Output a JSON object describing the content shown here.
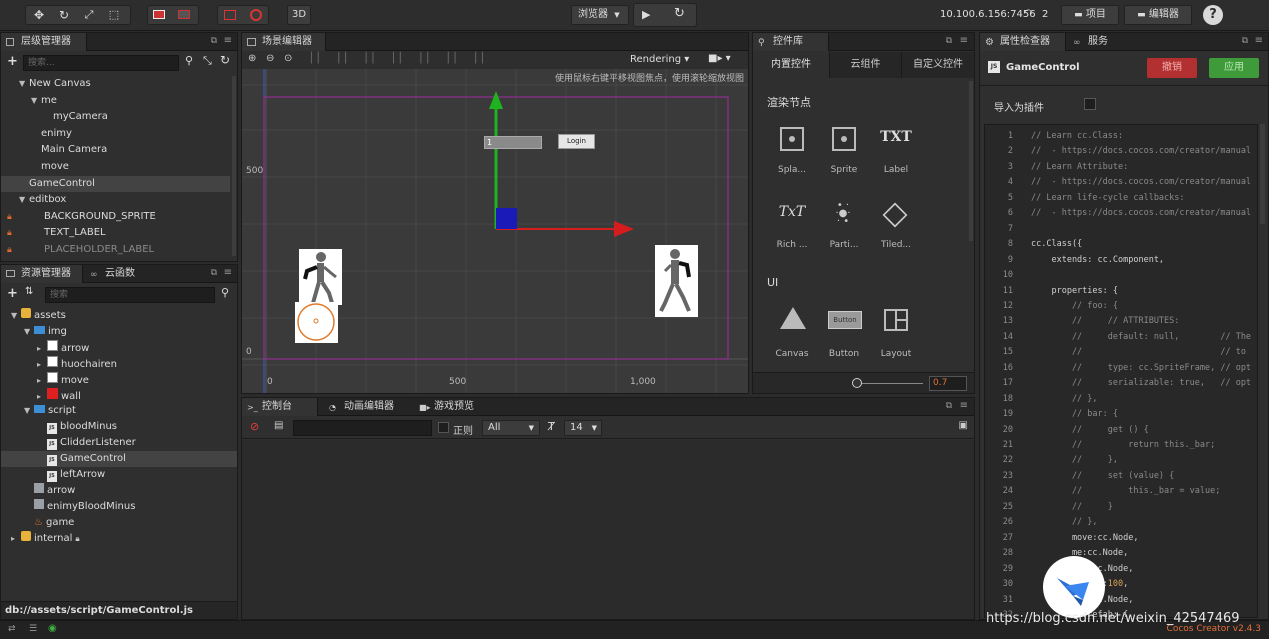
{
  "toolbar": {
    "transform_tools": [
      "move-tool",
      "rotate-tool",
      "scale-tool",
      "rect-tool"
    ],
    "mode_3d": "3D",
    "preview_target": "浏览器",
    "ip_address": "10.100.6.156:7456",
    "connections": "2",
    "project_label": "项目",
    "editor_label": "编辑器",
    "help": "?"
  },
  "hierarchy": {
    "title": "层级管理器",
    "search_placeholder": "搜索...",
    "items": [
      {
        "label": "New Canvas",
        "depth": 1,
        "expanded": true
      },
      {
        "label": "me",
        "depth": 2,
        "expanded": true
      },
      {
        "label": "myCamera",
        "depth": 3
      },
      {
        "label": "enimy",
        "depth": 2
      },
      {
        "label": "Main Camera",
        "depth": 2
      },
      {
        "label": "move",
        "depth": 2
      },
      {
        "label": "GameControl",
        "depth": 1,
        "selected": true
      },
      {
        "label": "editbox",
        "depth": 1,
        "expanded": true
      },
      {
        "label": "BACKGROUND_SPRITE",
        "depth": 2,
        "locked": true
      },
      {
        "label": "TEXT_LABEL",
        "depth": 2,
        "locked": true
      },
      {
        "label": "PLACEHOLDER_LABEL",
        "depth": 2,
        "locked": true,
        "dim": true
      }
    ]
  },
  "assets": {
    "tab_assets": "资源管理器",
    "tab_cloud": "云函数",
    "search_placeholder": "搜索",
    "items": [
      {
        "label": "assets",
        "depth": 0,
        "type": "db"
      },
      {
        "label": "img",
        "depth": 1,
        "type": "folder"
      },
      {
        "label": "arrow",
        "depth": 2,
        "type": "image"
      },
      {
        "label": "huochairen",
        "depth": 2,
        "type": "image"
      },
      {
        "label": "move",
        "depth": 2,
        "type": "image"
      },
      {
        "label": "wall",
        "depth": 2,
        "type": "image-red"
      },
      {
        "label": "script",
        "depth": 1,
        "type": "folder"
      },
      {
        "label": "bloodMinus",
        "depth": 2,
        "type": "js"
      },
      {
        "label": "ClidderListener",
        "depth": 2,
        "type": "js"
      },
      {
        "label": "GameControl",
        "depth": 2,
        "type": "js",
        "selected": true
      },
      {
        "label": "leftArrow",
        "depth": 2,
        "type": "js"
      },
      {
        "label": "arrow",
        "depth": 1,
        "type": "prefab"
      },
      {
        "label": "enimyBloodMinus",
        "depth": 1,
        "type": "prefab"
      },
      {
        "label": "game",
        "depth": 1,
        "type": "scene"
      },
      {
        "label": "internal",
        "depth": 0,
        "type": "db-lock"
      }
    ],
    "path": "db://assets/script/GameControl.js"
  },
  "scene": {
    "title": "场景编辑器",
    "rendering": "Rendering",
    "hint": "使用鼠标右键平移视图焦点，使用滚轮缩放视图",
    "y_labels": [
      "500",
      "0"
    ],
    "x_labels": [
      "0",
      "500",
      "1,000"
    ],
    "editbox_value": "1",
    "login_button": "Login"
  },
  "bottom": {
    "tabs": [
      "控制台",
      "动画编辑器",
      "游戏预览"
    ],
    "regex_label": "正则",
    "filter": "All",
    "font_size": "14"
  },
  "widgets": {
    "title": "控件库",
    "tabs": [
      "内置控件",
      "云组件",
      "自定义控件"
    ],
    "section_render": "渲染节点",
    "section_ui": "UI",
    "render_items": [
      "Spla...",
      "Sprite",
      "Label",
      "Rich ...",
      "Parti...",
      "Tiled..."
    ],
    "ui_items": [
      "Canvas",
      "Button",
      "Layout"
    ],
    "zoom": "0.7"
  },
  "inspector": {
    "tab_inspector": "属性检查器",
    "tab_service": "服务",
    "file_name": "GameControl",
    "revert_label": "撤销",
    "apply_label": "应用",
    "import_plugin": "导入为插件",
    "code": [
      {
        "n": "1",
        "t": "// Learn cc.Class:",
        "c": "cmt"
      },
      {
        "n": "2",
        "t": "//  - https://docs.cocos.com/creator/manual",
        "c": "cmt"
      },
      {
        "n": "3",
        "t": "// Learn Attribute:",
        "c": "cmt"
      },
      {
        "n": "4",
        "t": "//  - https://docs.cocos.com/creator/manual",
        "c": "cmt"
      },
      {
        "n": "5",
        "t": "// Learn life-cycle callbacks:",
        "c": "cmt"
      },
      {
        "n": "6",
        "t": "//  - https://docs.cocos.com/creator/manual",
        "c": "cmt"
      },
      {
        "n": "7",
        "t": "",
        "c": "cw"
      },
      {
        "n": "8",
        "t": "cc.Class({",
        "c": "cw"
      },
      {
        "n": "9",
        "t": "    extends: cc.Component,",
        "c": "cw"
      },
      {
        "n": "10",
        "t": "",
        "c": "cw"
      },
      {
        "n": "11",
        "t": "    properties: {",
        "c": "cw"
      },
      {
        "n": "12",
        "t": "        // foo: {",
        "c": "cmt"
      },
      {
        "n": "13",
        "t": "        //     // ATTRIBUTES:",
        "c": "cmt"
      },
      {
        "n": "14",
        "t": "        //     default: null,        // The",
        "c": "cmt"
      },
      {
        "n": "15",
        "t": "        //                           // to",
        "c": "cmt"
      },
      {
        "n": "16",
        "t": "        //     type: cc.SpriteFrame, // opt",
        "c": "cmt"
      },
      {
        "n": "17",
        "t": "        //     serializable: true,   // opt",
        "c": "cmt"
      },
      {
        "n": "18",
        "t": "        // },",
        "c": "cmt"
      },
      {
        "n": "19",
        "t": "        // bar: {",
        "c": "cmt"
      },
      {
        "n": "20",
        "t": "        //     get () {",
        "c": "cmt"
      },
      {
        "n": "21",
        "t": "        //         return this._bar;",
        "c": "cmt"
      },
      {
        "n": "22",
        "t": "        //     },",
        "c": "cmt"
      },
      {
        "n": "23",
        "t": "        //     set (value) {",
        "c": "cmt"
      },
      {
        "n": "24",
        "t": "        //         this._bar = value;",
        "c": "cmt"
      },
      {
        "n": "25",
        "t": "        //     }",
        "c": "cmt"
      },
      {
        "n": "26",
        "t": "        // },",
        "c": "cmt"
      },
      {
        "n": "27",
        "t": "        move:cc.Node,",
        "c": "cw"
      },
      {
        "n": "28",
        "t": "        me:cc.Node,",
        "c": "cw"
      },
      {
        "n": "29",
        "t": "        ...:cc.Node,",
        "c": "cw"
      },
      {
        "n": "30",
        "t": "        ...eed:100,",
        "c": "cw"
      },
      {
        "n": "31",
        "t": "        ...:cc.Node,",
        "c": "cw"
      },
      {
        "n": "32",
        "t": "        ...refab: {",
        "c": "cw"
      }
    ]
  },
  "status": {
    "watermark": "https://blog.csdn.net/weixin_42547469",
    "version": "Cocos Creator v2.4.3"
  },
  "colors": {
    "apply_green": "#3f9a3a",
    "revert_red": "#b23030",
    "accent_orange": "#e06a2c",
    "axis_green": "#1fb31f",
    "axis_red": "#d51d1d"
  }
}
